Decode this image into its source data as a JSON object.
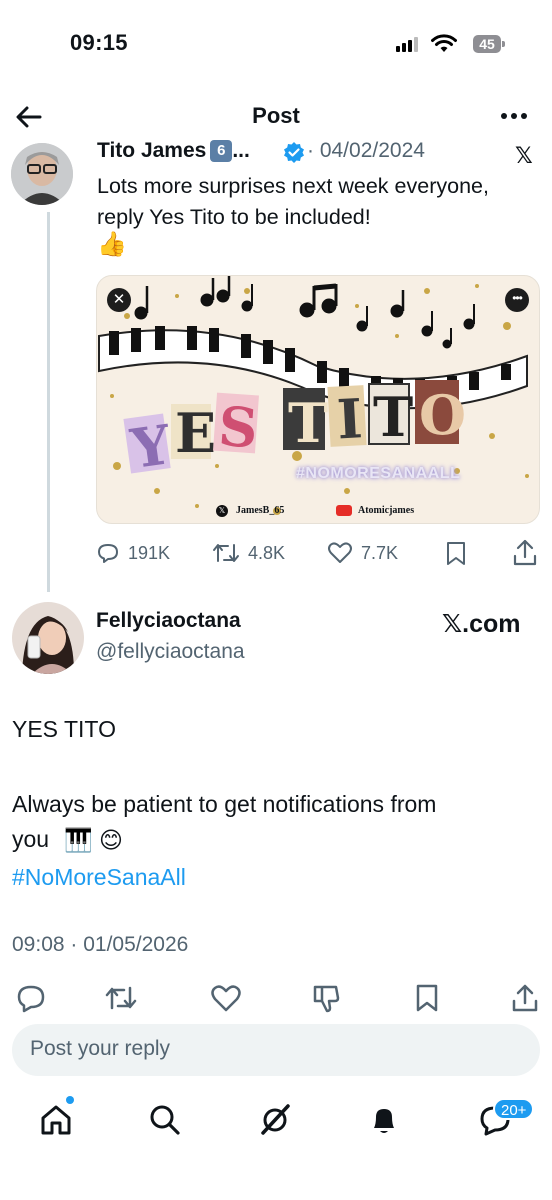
{
  "status_bar": {
    "time": "09:15",
    "battery": "45",
    "icons": [
      "signal-icon",
      "wifi-icon",
      "battery-icon"
    ]
  },
  "header": {
    "title": "Post",
    "back_icon": "back-arrow-icon",
    "more_icon": "more-icon"
  },
  "parent_post": {
    "author_name": "Tito James",
    "badge": "6",
    "ellipsis": "...",
    "date": "· 04/02/2024",
    "text": "Lots more surprises next week everyone, reply Yes Tito to be included!",
    "emoji": "👍",
    "platform_icon": "x-logo-icon",
    "media": {
      "title": "YES TITO",
      "hashtag": "#NOMORESANAALL",
      "handle_x": "JamesB_65",
      "handle_youtube": "Atomicjames"
    },
    "stats": {
      "replies": "191K",
      "reposts": "4.8K",
      "likes": "7.7K"
    }
  },
  "post": {
    "author_name": "Fellyciaoctana",
    "handle": "@fellyciaoctana",
    "source": "𝕏.com",
    "line1": "YES TITO",
    "line2": "Always be patient to get notifications from",
    "line3": "you",
    "emojis": "🎹 😊",
    "hashtag": "#NoMoreSanaAll",
    "timestamp": "09:08 · 01/05/2026"
  },
  "reply": {
    "placeholder": "Post your reply"
  },
  "bottom_nav": {
    "items": [
      "home-icon",
      "search-icon",
      "grok-icon",
      "notifications-icon",
      "messages-icon"
    ],
    "messages_badge": "20+"
  },
  "colors": {
    "accent": "#1d9bf0",
    "text": "#0f1419",
    "muted": "#536471"
  }
}
